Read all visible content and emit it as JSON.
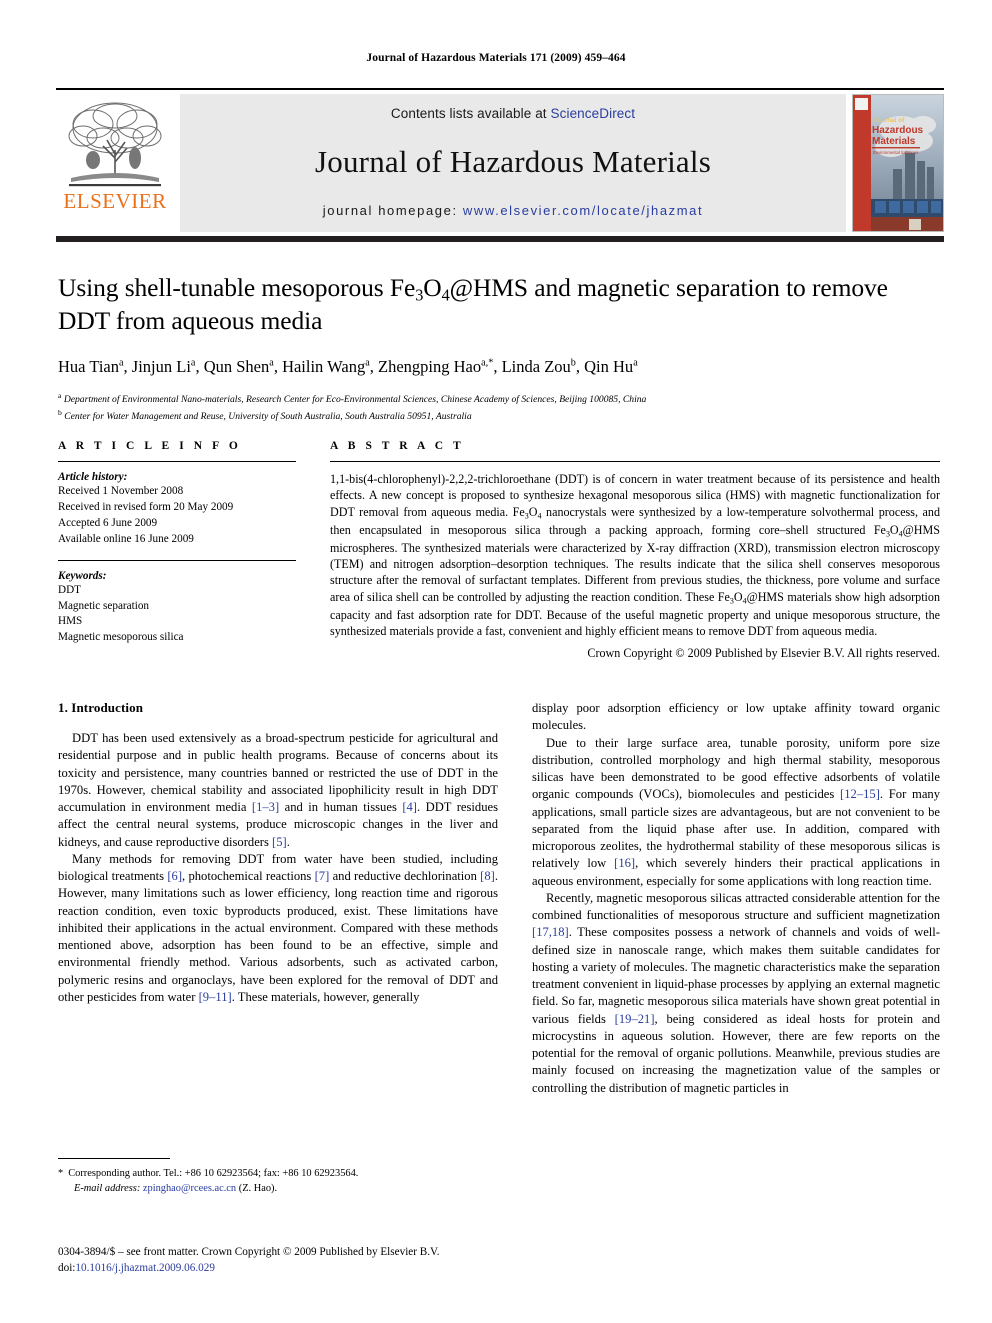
{
  "running_head": "Journal of Hazardous Materials 171 (2009) 459–464",
  "masthead": {
    "contents_prefix": "Contents lists available at ",
    "sciencedirect": "ScienceDirect",
    "journal_title": "Journal of Hazardous Materials",
    "homepage_prefix": "journal homepage: ",
    "homepage_url": "www.elsevier.com/locate/jhazmat",
    "publisher_wordmark": "ELSEVIER",
    "publisher_logo_icon": "elsevier-tree-icon",
    "cover_icon": "journal-cover-thumbnail",
    "cover_title_line1": "Journal of",
    "cover_title_line2": "Hazardous",
    "cover_title_line3": "Materials",
    "accent_color": "#E9711C",
    "link_color": "#2a3d9e"
  },
  "article": {
    "title": "Using shell-tunable mesoporous Fe3O4@HMS and magnetic separation to remove DDT from aqueous media",
    "authors": "Hua Tian a, Jinjun Li a, Qun Shen a, Hailin Wang a, Zhengping Hao a,*, Linda Zou b, Qin Hu a",
    "affiliation_a": "Department of Environmental Nano-materials, Research Center for Eco-Environmental Sciences, Chinese Academy of Sciences, Beijing 100085, China",
    "affiliation_b": "Center for Water Management and Reuse, University of South Australia, South Australia 50951, Australia"
  },
  "article_info": {
    "heading": "A R T I C L E    I N F O",
    "history_label": "Article history:",
    "history": [
      "Received 1 November 2008",
      "Received in revised form 20 May 2009",
      "Accepted 6 June 2009",
      "Available online 16 June 2009"
    ],
    "keywords_label": "Keywords:",
    "keywords": [
      "DDT",
      "Magnetic separation",
      "HMS",
      "Magnetic mesoporous silica"
    ]
  },
  "abstract": {
    "heading": "A B S T R A C T",
    "text_part1": "1,1-bis(4-chlorophenyl)-2,2,2-trichloroethane (DDT) is of concern in water treatment because of its persistence and health effects. A new concept is proposed to synthesize hexagonal mesoporous silica (HMS) with magnetic functionalization for DDT removal from aqueous media. Fe",
    "sub1": "3",
    "text_part2": "O",
    "sub2": "4",
    "text_part3": " nanocrystals were synthesized by a low-temperature solvothermal process, and then encapsulated in mesoporous silica through a packing approach, forming core–shell structured Fe",
    "sub3": "3",
    "text_part4": "O",
    "sub4": "4",
    "text_part5": "@HMS microspheres. The synthesized materials were characterized by X-ray diffraction (XRD), transmission electron microscopy (TEM) and nitrogen adsorption–desorption techniques. The results indicate that the silica shell conserves mesoporous structure after the removal of surfactant templates. Different from previous studies, the thickness, pore volume and surface area of silica shell can be controlled by adjusting the reaction condition. These Fe",
    "sub5": "3",
    "text_part6": "O",
    "sub6": "4",
    "text_part7": "@HMS materials show high adsorption capacity and fast adsorption rate for DDT. Because of the useful magnetic property and unique mesoporous structure, the synthesized materials provide a fast, convenient and highly efficient means to remove DDT from aqueous media.",
    "copyright": "Crown Copyright © 2009 Published by Elsevier B.V. All rights reserved."
  },
  "introduction": {
    "section_number_title": "1.  Introduction",
    "left_p1_a": "DDT has been used extensively as a broad-spectrum pesticide for agricultural and residential purpose and in public health programs. Because of concerns about its toxicity and persistence, many countries banned or restricted the use of DDT in the 1970s. However, chemical stability and associated lipophilicity result in high DDT accumulation in environment media ",
    "ref_1_3": "[1–3]",
    "left_p1_b": " and in human tissues ",
    "ref_4": "[4]",
    "left_p1_c": ". DDT residues affect the central neural systems, produce microscopic changes in the liver and kidneys, and cause reproductive disorders ",
    "ref_5": "[5]",
    "left_p1_d": ".",
    "left_p2_a": "Many methods for removing DDT from water have been studied, including biological treatments ",
    "ref_6": "[6]",
    "left_p2_b": ", photochemical reactions ",
    "ref_7": "[7]",
    "left_p2_c": " and reductive dechlorination ",
    "ref_8": "[8]",
    "left_p2_d": ". However, many limitations such as lower efficiency, long reaction time and rigorous reaction condition, even toxic byproducts produced, exist. These limitations have inhibited their applications in the actual environment. Compared with these methods mentioned above, adsorption has been found to be an effective, simple and environmental friendly method. Various adsorbents, such as activated carbon, polymeric resins and organoclays, have been explored for the removal of DDT and other pesticides from water ",
    "ref_9_11": "[9–11]",
    "left_p2_e": ". These materials, however, generally",
    "right_p1": "display poor adsorption efficiency or low uptake affinity toward organic molecules.",
    "right_p2_a": "Due to their large surface area, tunable porosity, uniform pore size distribution, controlled morphology and high thermal stability, mesoporous silicas have been demonstrated to be good effective adsorbents of volatile organic compounds (VOCs), biomolecules and pesticides ",
    "ref_12_15": "[12–15]",
    "right_p2_b": ". For many applications, small particle sizes are advantageous, but are not convenient to be separated from the liquid phase after use. In addition, compared with microporous zeolites, the hydrothermal stability of these mesoporous silicas is relatively low ",
    "ref_16": "[16]",
    "right_p2_c": ", which severely hinders their practical applications in aqueous environment, especially for some applications with long reaction time.",
    "right_p3_a": "Recently, magnetic mesoporous silicas attracted considerable attention for the combined functionalities of mesoporous structure and sufficient magnetization ",
    "ref_17_18": "[17,18]",
    "right_p3_b": ". These composites possess a network of channels and voids of well-defined size in nanoscale range, which makes them suitable candidates for hosting a variety of molecules. The magnetic characteristics make the separation treatment convenient in liquid-phase processes by applying an external magnetic field. So far, magnetic mesoporous silica materials have shown great potential in various fields ",
    "ref_19_21": "[19–21]",
    "right_p3_c": ", being considered as ideal hosts for protein and microcystins in aqueous solution. However, there are few reports on the potential for the removal of organic pollutions. Meanwhile, previous studies are mainly focused on increasing the magnetization value of the samples or controlling the distribution of magnetic particles in"
  },
  "footnote": {
    "star": "*",
    "corresponding": "Corresponding author. Tel.: +86 10 62923564; fax: +86 10 62923564.",
    "email_label": "E-mail address:",
    "email": "zpinghao@rcees.ac.cn",
    "email_suffix": "(Z. Hao)."
  },
  "page_footer": {
    "front_matter": "0304-3894/$ – see front matter. Crown Copyright © 2009 Published by Elsevier B.V.",
    "doi_label": "doi:",
    "doi": "10.1016/j.jhazmat.2009.06.029"
  }
}
